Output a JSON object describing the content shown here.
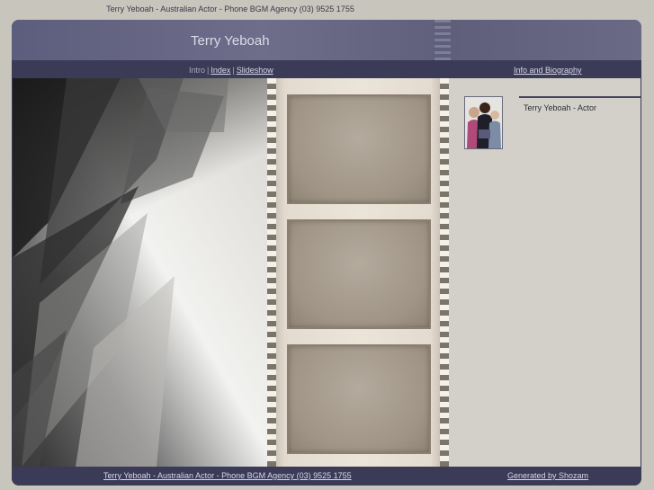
{
  "page": {
    "top_caption": "Terry Yeboah - Australian Actor - Phone BGM Agency (03) 9525 1755"
  },
  "header": {
    "site_title": "Terry Yeboah"
  },
  "nav": {
    "current_label": "Intro",
    "separator": "|",
    "index_label": "Index",
    "slideshow_label": "Slideshow",
    "bio_label": "Info and Biography"
  },
  "sidebar": {
    "caption": "Terry Yeboah - Actor"
  },
  "footer": {
    "left_link": "Terry Yeboah - Australian Actor - Phone BGM Agency (03) 9525 1755",
    "right_link": "Generated by Shozam"
  },
  "colors": {
    "frame_bg": "#3b3a57",
    "header_bg": "#6e6d8a",
    "content_bg": "#d2d0c8",
    "link_color": "#d8d8e8"
  }
}
